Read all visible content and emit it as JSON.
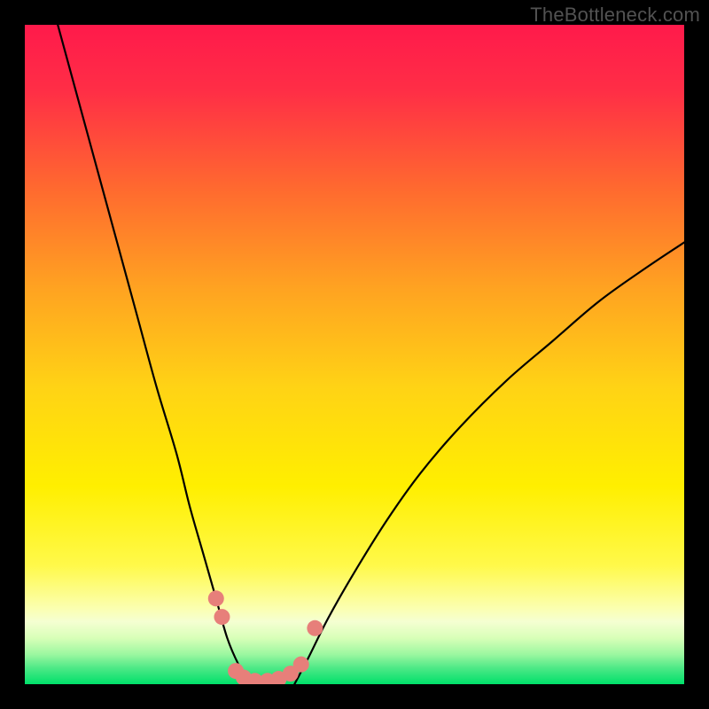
{
  "watermark": "TheBottleneck.com",
  "chart_data": {
    "type": "line",
    "title": "",
    "xlabel": "",
    "ylabel": "",
    "xlim": [
      0,
      100
    ],
    "ylim": [
      0,
      100
    ],
    "grid": false,
    "legend": false,
    "background_gradient": {
      "top": "#ff1a4b",
      "upper_mid": "#ff7a2a",
      "mid": "#ffe600",
      "lower_mid": "#f7ff8a",
      "bottom": "#00e66b"
    },
    "series": [
      {
        "name": "left-curve",
        "x": [
          5,
          8,
          11,
          14,
          17,
          20,
          23,
          25,
          27,
          29,
          30.7,
          32.4,
          34.2
        ],
        "y": [
          100,
          89,
          78,
          67,
          56,
          45,
          35,
          27,
          20,
          13,
          7,
          3,
          0
        ]
      },
      {
        "name": "right-curve",
        "x": [
          40.9,
          43,
          46,
          50,
          55,
          60,
          66,
          73,
          80,
          87,
          94,
          100
        ],
        "y": [
          0,
          4,
          10,
          17,
          25,
          32,
          39,
          46,
          52,
          58,
          63,
          67
        ]
      }
    ],
    "markers": [
      {
        "x": 29.0,
        "y": 13.0
      },
      {
        "x": 29.9,
        "y": 10.2
      },
      {
        "x": 32.0,
        "y": 2.0
      },
      {
        "x": 33.2,
        "y": 1.0
      },
      {
        "x": 34.9,
        "y": 0.5
      },
      {
        "x": 36.8,
        "y": 0.5
      },
      {
        "x": 38.5,
        "y": 0.8
      },
      {
        "x": 40.3,
        "y": 1.6
      },
      {
        "x": 41.9,
        "y": 3.0
      },
      {
        "x": 44.0,
        "y": 8.5
      }
    ],
    "marker_style": {
      "color": "#e77f7a",
      "radius_px": 9
    }
  }
}
